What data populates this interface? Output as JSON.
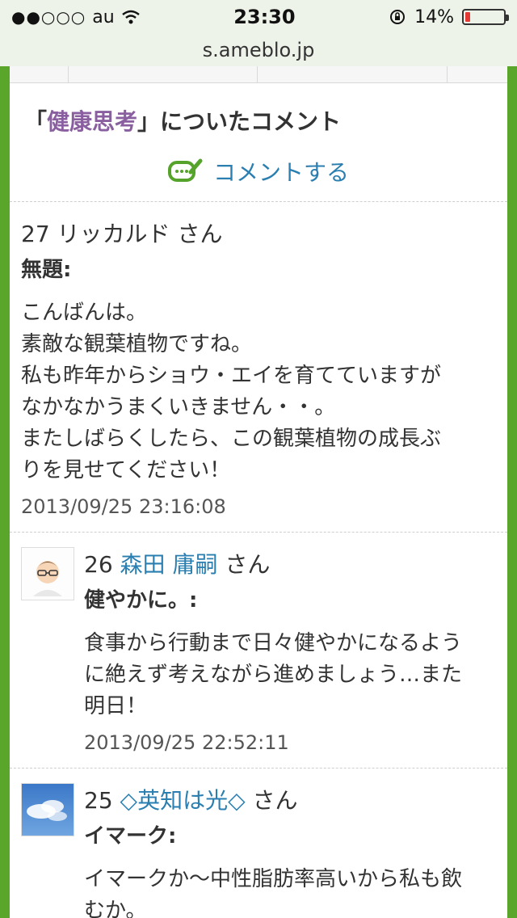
{
  "status_bar": {
    "carrier": "au",
    "time": "23:30",
    "battery": "14%",
    "battery_level": 0.14
  },
  "browser": {
    "url": "s.ameblo.jp"
  },
  "page": {
    "title_open": "「",
    "title_highlight": "健康思考",
    "title_close": "」についたコメント",
    "comment_link": "コメントする"
  },
  "comments": [
    {
      "number": "27",
      "name": "リッカルド",
      "honorific": "さん",
      "subject": "無題:",
      "lines": [
        "こんばんは。",
        "素敵な観葉植物ですね。",
        "私も昨年からショウ・エイを育てていますが",
        "なかなかうまくいきません・・。",
        "またしばらくしたら、この観葉植物の成長ぶ",
        "りを見せてください！"
      ],
      "date": "2013/09/25 23:16:08"
    },
    {
      "number": "26",
      "name": "森田 庸嗣",
      "honorific": "さん",
      "subject": "健やかに。:",
      "lines": [
        "食事から行動まで日々健やかになるよう",
        "に絶えず考えながら進めましょう…また",
        "明日！"
      ],
      "date": "2013/09/25 22:52:11"
    },
    {
      "number": "25",
      "name": "◇英知は光◇",
      "honorific": "さん",
      "subject": "イマーク:",
      "lines": [
        "イマークか〜中性脂肪率高いから私も飲",
        "むか。"
      ],
      "date": ""
    }
  ]
}
